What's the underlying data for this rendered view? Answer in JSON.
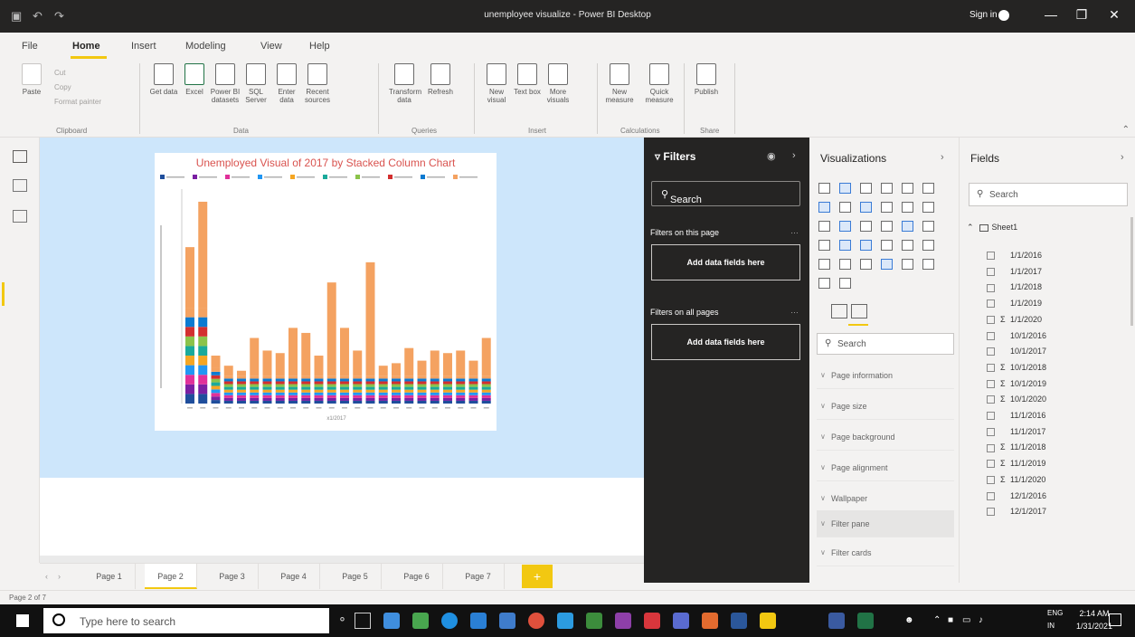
{
  "window": {
    "title": "unemployee visualize - Power BI Desktop",
    "sign_in": "Sign in"
  },
  "menu": {
    "items": [
      "File",
      "Home",
      "Insert",
      "Modeling",
      "View",
      "Help"
    ],
    "active": "Home"
  },
  "ribbon": {
    "clipboard": {
      "paste": "Paste",
      "cut": "Cut",
      "copy": "Copy",
      "format_painter": "Format painter",
      "group": "Clipboard"
    },
    "data": {
      "buttons": [
        "Get data",
        "Excel",
        "Power BI datasets",
        "SQL Server",
        "Enter data",
        "Recent sources"
      ],
      "group": "Data"
    },
    "queries": {
      "buttons": [
        "Transform data",
        "Refresh"
      ],
      "group": "Queries"
    },
    "insert": {
      "buttons": [
        "New visual",
        "Text box",
        "More visuals"
      ],
      "group": "Insert"
    },
    "calculations": {
      "buttons": [
        "New measure",
        "Quick measure"
      ],
      "group": "Calculations"
    },
    "share": {
      "buttons": [
        "Publish"
      ],
      "group": "Share"
    }
  },
  "chart_data": {
    "type": "bar",
    "stacked": true,
    "title": "Unemployed Visual of 2017 by Stacked Column Chart",
    "xlabel": "x1/2017",
    "legend_position": "top",
    "series_colors": [
      "#1f4e9c",
      "#7a1fa2",
      "#e0309a",
      "#2196f3",
      "#f5a623",
      "#1aaa9b",
      "#8bc34a",
      "#d32f2f",
      "#0b7ad1",
      "#f4a261"
    ],
    "top_color": "#f4a261",
    "totals": [
      62,
      80,
      19,
      15,
      13,
      26,
      21,
      20,
      30,
      28,
      19,
      48,
      30,
      21,
      56,
      15,
      16,
      22,
      17,
      21,
      20,
      21,
      17,
      26
    ],
    "stack_base": [
      38,
      38,
      14,
      11,
      11,
      11,
      11,
      11,
      11,
      11,
      11,
      11,
      11,
      11,
      11,
      11,
      11,
      11,
      11,
      11,
      11,
      11,
      11,
      11
    ],
    "ylim": [
      0,
      85
    ]
  },
  "filters": {
    "title": "Filters",
    "search": "Search",
    "this_page": "Filters on this page",
    "all_pages": "Filters on all pages",
    "add_fields": "Add data fields here"
  },
  "visualizations": {
    "title": "Visualizations",
    "search": "Search",
    "cards": [
      "Page information",
      "Page size",
      "Page background",
      "Page alignment",
      "Wallpaper",
      "Filter pane",
      "Filter cards"
    ]
  },
  "fields": {
    "title": "Fields",
    "search": "Search",
    "table": "Sheet1",
    "items": [
      {
        "label": "1/1/2016",
        "sigma": false
      },
      {
        "label": "1/1/2017",
        "sigma": false
      },
      {
        "label": "1/1/2018",
        "sigma": false
      },
      {
        "label": "1/1/2019",
        "sigma": false
      },
      {
        "label": "1/1/2020",
        "sigma": true
      },
      {
        "label": "10/1/2016",
        "sigma": false
      },
      {
        "label": "10/1/2017",
        "sigma": false
      },
      {
        "label": "10/1/2018",
        "sigma": true
      },
      {
        "label": "10/1/2019",
        "sigma": true
      },
      {
        "label": "10/1/2020",
        "sigma": true
      },
      {
        "label": "11/1/2016",
        "sigma": false
      },
      {
        "label": "11/1/2017",
        "sigma": false
      },
      {
        "label": "11/1/2018",
        "sigma": true
      },
      {
        "label": "11/1/2019",
        "sigma": true
      },
      {
        "label": "11/1/2020",
        "sigma": true
      },
      {
        "label": "12/1/2016",
        "sigma": false
      },
      {
        "label": "12/1/2017",
        "sigma": false
      }
    ]
  },
  "pages": {
    "tabs": [
      "Page 1",
      "Page 2",
      "Page 3",
      "Page 4",
      "Page 5",
      "Page 6",
      "Page 7"
    ],
    "active": "Page 2",
    "add": "+"
  },
  "status": {
    "text": "Page 2 of 7"
  },
  "taskbar": {
    "search_placeholder": "Type here to search",
    "lang1": "ENG",
    "lang2": "IN",
    "time": "2:14 AM",
    "date": "1/31/2021"
  }
}
